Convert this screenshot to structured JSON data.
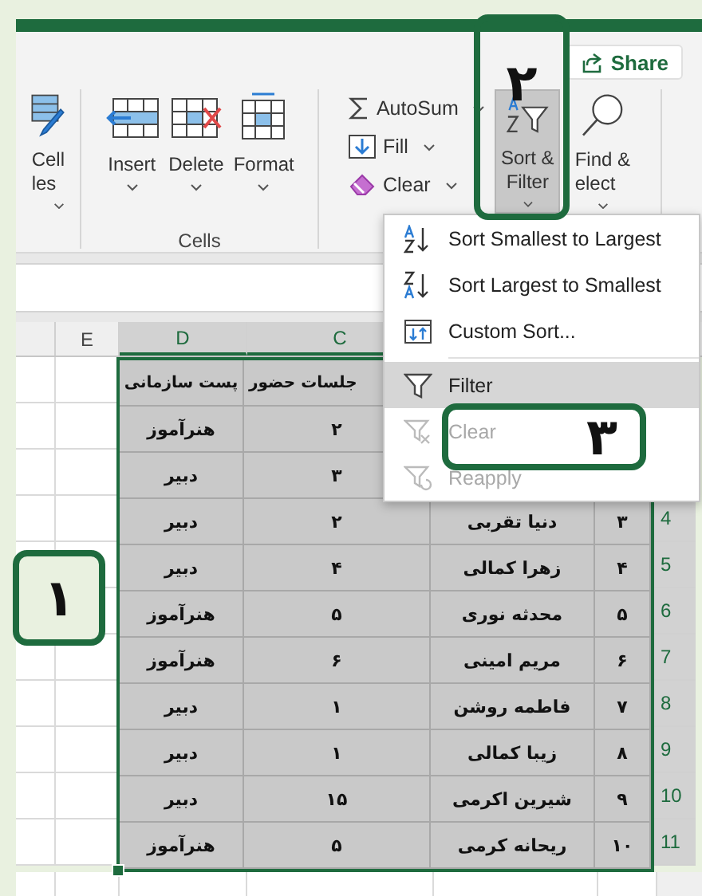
{
  "ribbon": {
    "share_button": "Share",
    "groups": [
      {
        "buttons": [
          {
            "kind": "find",
            "lines": [
              "Find &",
              "elect"
            ],
            "dropdown": true,
            "pressed": false
          },
          {
            "kind": "sort_filter",
            "lines": [
              "Sort &",
              "Filter"
            ],
            "dropdown": true,
            "pressed": true
          }
        ],
        "small_buttons": [
          {
            "kind": "autosum",
            "label": "AutoSum",
            "dropdown": true
          },
          {
            "kind": "fill",
            "label": "Fill",
            "dropdown": true
          },
          {
            "kind": "clear",
            "label": "Clear",
            "dropdown": true
          }
        ]
      },
      {
        "label": "Cells",
        "buttons": [
          {
            "kind": "format",
            "lines": [
              "Format"
            ],
            "dropdown": true,
            "pressed": false
          },
          {
            "kind": "delete",
            "lines": [
              "Delete"
            ],
            "dropdown": true,
            "pressed": false
          },
          {
            "kind": "insert",
            "lines": [
              "Insert"
            ],
            "dropdown": true,
            "pressed": false
          }
        ]
      },
      {
        "buttons": [
          {
            "kind": "cell_styles",
            "lines": [
              "Cell",
              "les"
            ],
            "dropdown": true,
            "pressed": false
          }
        ]
      }
    ]
  },
  "sheet": {
    "columns": [
      {
        "letter": "C",
        "selected": true
      },
      {
        "letter": "D",
        "selected": true
      },
      {
        "letter": "E",
        "selected": false
      }
    ],
    "rows": [
      {
        "selected": true,
        "cells": {
          "d": "پست سازمانی",
          "c": "جلسات حضور"
        }
      },
      {
        "selected": true,
        "cells": {
          "d": "هنرآموز",
          "c": "۲"
        }
      },
      {
        "selected": true,
        "cells": {
          "d": "دبیر",
          "c": "۳"
        }
      },
      {
        "number": "4",
        "selected": true,
        "cells": {
          "d": "دبیر",
          "c": "۲",
          "b": "دنیا تقربی",
          "a": "۳"
        }
      },
      {
        "number": "5",
        "selected": true,
        "cells": {
          "d": "دبیر",
          "c": "۴",
          "b": "زهرا کمالی",
          "a": "۴"
        }
      },
      {
        "number": "6",
        "selected": true,
        "cells": {
          "d": "هنرآموز",
          "c": "۵",
          "b": "محدثه نوری",
          "a": "۵"
        }
      },
      {
        "number": "7",
        "selected": true,
        "cells": {
          "d": "هنرآموز",
          "c": "۶",
          "b": "مریم امینی",
          "a": "۶"
        }
      },
      {
        "number": "8",
        "selected": true,
        "cells": {
          "d": "دبیر",
          "c": "۱",
          "b": "فاطمه روشن",
          "a": "۷"
        }
      },
      {
        "number": "9",
        "selected": true,
        "cells": {
          "d": "دبیر",
          "c": "۱",
          "b": "زیبا کمالی",
          "a": "۸"
        }
      },
      {
        "number": "10",
        "selected": true,
        "cells": {
          "d": "دبیر",
          "c": "۱۵",
          "b": "شیرین اکرمی",
          "a": "۹"
        }
      },
      {
        "number": "11",
        "selected": true,
        "cells": {
          "d": "هنرآموز",
          "c": "۵",
          "b": "ریحانه کرمی",
          "a": "۱۰"
        }
      }
    ]
  },
  "menu": {
    "items": [
      {
        "kind": "sort_asc",
        "label": "Sort Smallest to Largest",
        "highlighted": false,
        "disabled": false
      },
      {
        "kind": "sort_desc",
        "label": "Sort Largest to Smallest",
        "highlighted": false,
        "disabled": false
      },
      {
        "kind": "custom_sort",
        "label": "Custom Sort...",
        "highlighted": false,
        "disabled": false
      },
      {
        "kind": "filter",
        "label": "Filter",
        "highlighted": true,
        "disabled": false
      },
      {
        "kind": "clear_filter",
        "label": "Clear",
        "highlighted": false,
        "disabled": true
      },
      {
        "kind": "reapply",
        "label": "Reapply",
        "highlighted": false,
        "disabled": true
      }
    ]
  },
  "annotations": [
    {
      "label": "۲"
    },
    {
      "label": "۳"
    },
    {
      "label": "۱"
    }
  ]
}
